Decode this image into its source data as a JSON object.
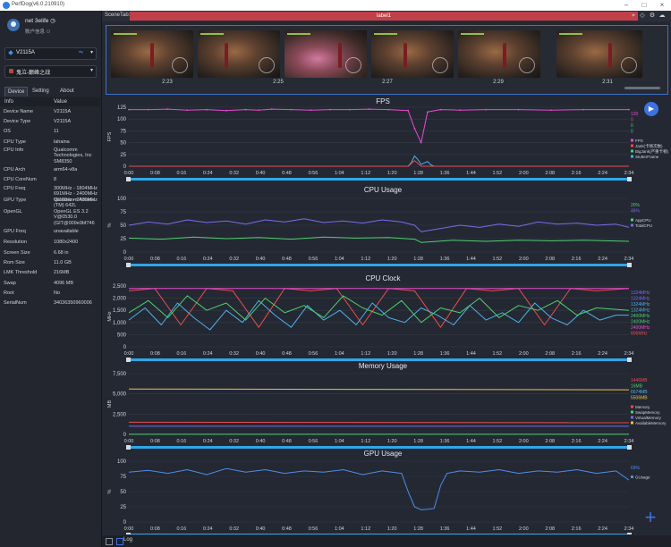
{
  "window": {
    "title": "PerfDog(v6.0.210910)"
  },
  "user": {
    "name": "net 3elife",
    "info_label": "账户信息"
  },
  "device_select": {
    "label": "V2115A"
  },
  "app_select": {
    "label": "鬼泣-巅峰之战"
  },
  "tabs": [
    "Device",
    "Setting",
    "About"
  ],
  "info_table": {
    "header": [
      "Info",
      "Value"
    ],
    "rows": [
      {
        "k": "Device Name",
        "v": "V2115A"
      },
      {
        "k": "Device Type",
        "v": "V2115A"
      },
      {
        "k": "OS",
        "v": "11"
      },
      {
        "k": "CPU Type",
        "v": "lahaina"
      },
      {
        "k": "CPU Info",
        "v": "Qualcomm Technologies, Inc SM8350"
      },
      {
        "k": "CPU Arch",
        "v": "arm64-v8a"
      },
      {
        "k": "CPU CoreNum",
        "v": "8"
      },
      {
        "k": "CPU Freq",
        "v": "300MHz - 1804MHz 691MHz - 2400MHz 691MHz - 2400MHz"
      },
      {
        "k": "GPU Type",
        "v": "Qualcomm Adreno (TM) 642L"
      },
      {
        "k": "OpenGL",
        "v": "OpenGL ES 3.2 V@0530.0 (GIT@009e9bf746"
      },
      {
        "k": "GPU Freq",
        "v": "unavailable"
      },
      {
        "k": "Resolution",
        "v": "1080x2400"
      },
      {
        "k": "Screen Size",
        "v": "6.68 in"
      },
      {
        "k": "Rom Size",
        "v": "11.0 GB"
      },
      {
        "k": "LMK Threshold",
        "v": "216MB"
      },
      {
        "k": "Swap",
        "v": "4096 MB"
      },
      {
        "k": "Root",
        "v": "No"
      },
      {
        "k": "SerialNum",
        "v": "34036350960006"
      }
    ]
  },
  "scene": {
    "label": "SceneTab:",
    "tab": "label1"
  },
  "screenshots": {
    "times": [
      "2:23",
      "2:25",
      "2:27",
      "2:29",
      "2:31"
    ]
  },
  "time_ticks": [
    "0:00",
    "0:08",
    "0:16",
    "0:24",
    "0:32",
    "0:40",
    "0:48",
    "0:56",
    "1:04",
    "1:12",
    "1:20",
    "1:28",
    "1:36",
    "1:44",
    "1:52",
    "2:00",
    "2:08",
    "2:16",
    "2:24",
    "2:34"
  ],
  "colors": {
    "accent": "#3d72e0",
    "scrollbar": "#2fa7e6",
    "scene_tab": "#c0404a"
  },
  "chart_data": [
    {
      "type": "line",
      "title": "FPS",
      "ylabel": "FPS",
      "ylim": [
        0,
        125
      ],
      "yticks": [
        "0",
        "25",
        "50",
        "75",
        "100",
        "125"
      ],
      "legend_values": [
        {
          "text": "120",
          "color": "#e84dd0"
        },
        {
          "text": "0",
          "color": "#e84d4d"
        },
        {
          "text": "0",
          "color": "#4dd06e"
        },
        {
          "text": "0",
          "color": "#4db0e8"
        }
      ],
      "legend": [
        {
          "text": "FPS",
          "color": "#e84dd0"
        },
        {
          "text": "Jank(卡顿次数)",
          "color": "#e84d4d"
        },
        {
          "text": "BigJank(严重卡顿)",
          "color": "#4dd06e"
        },
        {
          "text": "StutterFrame",
          "color": "#4db0e8"
        }
      ],
      "series": [
        {
          "color": "#e84dd0",
          "x": [
            0,
            6,
            12,
            18,
            24,
            30,
            36,
            40,
            44,
            50,
            56,
            62,
            68,
            74,
            80,
            86,
            88,
            90,
            92,
            96,
            102,
            110,
            120,
            130,
            140,
            154
          ],
          "y": [
            120,
            120,
            121,
            119,
            120,
            118,
            120,
            119,
            121,
            120,
            119,
            120,
            120,
            121,
            120,
            118,
            80,
            50,
            115,
            120,
            119,
            120,
            120,
            119,
            120,
            120
          ]
        },
        {
          "color": "#4db0e8",
          "x": [
            0,
            86,
            87,
            88,
            89,
            90,
            92,
            93,
            94,
            154
          ],
          "y": [
            0,
            0,
            8,
            22,
            14,
            4,
            10,
            3,
            0,
            0
          ]
        },
        {
          "color": "#e84d4d",
          "x": [
            0,
            86,
            88,
            89,
            90,
            92,
            154
          ],
          "y": [
            0,
            0,
            12,
            6,
            0,
            0,
            0
          ]
        }
      ]
    },
    {
      "type": "line",
      "title": "CPU Usage",
      "ylabel": "%",
      "ylim": [
        0,
        100
      ],
      "yticks": [
        "0",
        "25",
        "50",
        "75",
        "100"
      ],
      "legend_values": [
        {
          "text": "20%",
          "color": "#4dd06e"
        },
        {
          "text": "46%",
          "color": "#7b6be8"
        }
      ],
      "legend": [
        {
          "text": "AppCPU",
          "color": "#4dd06e"
        },
        {
          "text": "TotalCPU",
          "color": "#7b6be8"
        }
      ],
      "series": [
        {
          "color": "#7b6be8",
          "x": [
            0,
            6,
            12,
            18,
            24,
            30,
            36,
            42,
            48,
            54,
            60,
            66,
            72,
            78,
            84,
            88,
            90,
            96,
            102,
            108,
            114,
            120,
            126,
            132,
            138,
            144,
            150,
            154
          ],
          "y": [
            50,
            56,
            52,
            60,
            55,
            58,
            52,
            60,
            56,
            62,
            55,
            58,
            54,
            60,
            56,
            50,
            38,
            44,
            50,
            46,
            52,
            48,
            56,
            52,
            54,
            50,
            52,
            46
          ]
        },
        {
          "color": "#4dd06e",
          "x": [
            0,
            10,
            20,
            30,
            40,
            50,
            60,
            70,
            80,
            88,
            90,
            100,
            110,
            120,
            130,
            140,
            154
          ],
          "y": [
            26,
            24,
            28,
            25,
            27,
            24,
            28,
            26,
            27,
            24,
            18,
            22,
            20,
            22,
            21,
            22,
            20
          ]
        }
      ]
    },
    {
      "type": "line",
      "title": "CPU Clock",
      "ylabel": "MHz",
      "ylim": [
        0,
        2500
      ],
      "yticks": [
        "0",
        "500",
        "1,000",
        "1,500",
        "2,000",
        "2,500"
      ],
      "legend_values": [
        {
          "text": "1324MHz",
          "color": "#7b6be8"
        },
        {
          "text": "1324MHz",
          "color": "#7b6be8"
        },
        {
          "text": "1324MHz",
          "color": "#4db0e8"
        },
        {
          "text": "1324MHz",
          "color": "#4db0e8"
        },
        {
          "text": "2400MHz",
          "color": "#4dd06e"
        },
        {
          "text": "2400MHz",
          "color": "#4dd06e"
        },
        {
          "text": "2400MHz",
          "color": "#e84dd0"
        },
        {
          "text": "806MHz",
          "color": "#e84d4d"
        }
      ],
      "legend": [],
      "series": [
        {
          "color": "#e84d4d",
          "x": [
            0,
            8,
            16,
            24,
            32,
            40,
            48,
            56,
            64,
            72,
            80,
            88,
            96,
            104,
            112,
            120,
            128,
            136,
            144,
            154
          ],
          "y": [
            2300,
            2400,
            900,
            2400,
            2300,
            800,
            2400,
            2300,
            2400,
            900,
            2400,
            2300,
            800,
            2400,
            2300,
            2400,
            900,
            2400,
            2300,
            2400
          ]
        },
        {
          "color": "#4db0e8",
          "x": [
            0,
            5,
            10,
            15,
            20,
            25,
            30,
            35,
            40,
            45,
            50,
            55,
            60,
            65,
            70,
            75,
            80,
            85,
            90,
            95,
            100,
            105,
            110,
            115,
            120,
            125,
            130,
            135,
            140,
            145,
            150,
            154
          ],
          "y": [
            1100,
            1600,
            900,
            1800,
            1200,
            700,
            1500,
            1000,
            1900,
            1300,
            800,
            1700,
            1100,
            1500,
            900,
            1800,
            1200,
            1000,
            1600,
            1300,
            900,
            1700,
            1100,
            1400,
            1000,
            1800,
            1200,
            900,
            1500,
            1100,
            1300,
            1300
          ]
        },
        {
          "color": "#4dd06e",
          "x": [
            0,
            6,
            12,
            18,
            24,
            30,
            36,
            42,
            48,
            54,
            60,
            66,
            72,
            78,
            84,
            90,
            96,
            102,
            108,
            114,
            120,
            126,
            132,
            138,
            144,
            154
          ],
          "y": [
            1400,
            1900,
            1200,
            2100,
            1500,
            1800,
            1100,
            2000,
            1400,
            1700,
            1200,
            2100,
            1600,
            1300,
            1900,
            1000,
            1600,
            1400,
            2000,
            1200,
            1700,
            1500,
            1900,
            1300,
            1600,
            1500
          ]
        },
        {
          "color": "#e84dd0",
          "x": [
            0,
            10,
            20,
            30,
            40,
            50,
            60,
            70,
            80,
            90,
            100,
            110,
            120,
            130,
            140,
            154
          ],
          "y": [
            2400,
            2400,
            2400,
            2400,
            2400,
            2400,
            2400,
            2400,
            2400,
            2400,
            2400,
            2400,
            2400,
            2400,
            2400,
            2400
          ]
        }
      ]
    },
    {
      "type": "line",
      "title": "Memory Usage",
      "ylabel": "MB",
      "ylim": [
        0,
        7500
      ],
      "yticks": [
        "0",
        "2,500",
        "5,000",
        "7,500"
      ],
      "legend_values": [
        {
          "text": "1446MB",
          "color": "#e84d4d"
        },
        {
          "text": "16MB",
          "color": "#4dd06e"
        },
        {
          "text": "6674MB",
          "color": "#4db0e8"
        },
        {
          "text": "5506MB",
          "color": "#e8c24d"
        }
      ],
      "legend": [
        {
          "text": "Memory",
          "color": "#e84d4d"
        },
        {
          "text": "SwapMemory",
          "color": "#4dd06e"
        },
        {
          "text": "VirtualMemory",
          "color": "#7b6be8"
        },
        {
          "text": "AvailableMemory",
          "color": "#e8c24d"
        }
      ],
      "series": [
        {
          "color": "#e8c24d",
          "x": [
            0,
            154
          ],
          "y": [
            5600,
            5500
          ]
        },
        {
          "color": "#e84d4d",
          "x": [
            0,
            154
          ],
          "y": [
            1500,
            1446
          ]
        },
        {
          "color": "#7b6be8",
          "x": [
            0,
            154
          ],
          "y": [
            1000,
            1000
          ]
        },
        {
          "color": "#4dd06e",
          "x": [
            0,
            154
          ],
          "y": [
            16,
            16
          ]
        }
      ]
    },
    {
      "type": "line",
      "title": "GPU Usage",
      "ylabel": "%",
      "ylim": [
        0,
        100
      ],
      "yticks": [
        "0",
        "25",
        "50",
        "75",
        "100"
      ],
      "legend_values": [
        {
          "text": "69%",
          "color": "#4d8ee8"
        }
      ],
      "legend": [
        {
          "text": "GUsage",
          "color": "#4d8ee8"
        }
      ],
      "series": [
        {
          "color": "#4d8ee8",
          "x": [
            0,
            6,
            12,
            18,
            24,
            30,
            36,
            42,
            48,
            54,
            60,
            66,
            72,
            78,
            84,
            86,
            88,
            90,
            94,
            96,
            98,
            102,
            108,
            114,
            120,
            126,
            132,
            138,
            144,
            150,
            154
          ],
          "y": [
            82,
            85,
            80,
            86,
            78,
            88,
            82,
            86,
            80,
            84,
            82,
            86,
            78,
            84,
            80,
            50,
            25,
            20,
            22,
            60,
            80,
            84,
            82,
            86,
            80,
            84,
            82,
            86,
            80,
            84,
            69
          ]
        }
      ]
    }
  ]
}
